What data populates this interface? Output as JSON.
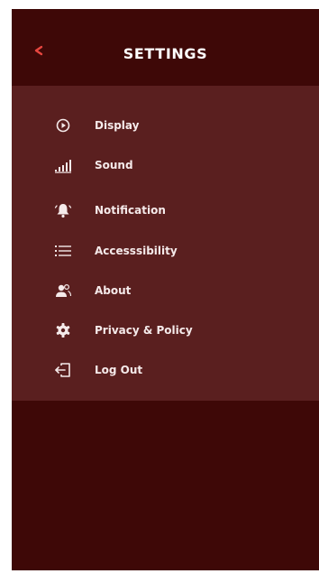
{
  "header": {
    "title": "SETTINGS",
    "back_icon": "chevron-left-icon",
    "accent": "#e8463f"
  },
  "menu": {
    "items": [
      {
        "label": "Display",
        "icon": "play-circle-icon"
      },
      {
        "label": "Sound",
        "icon": "equalizer-icon"
      },
      {
        "label": "Notification",
        "icon": "bell-ringing-icon"
      },
      {
        "label": "Accesssibility",
        "icon": "list-icon"
      },
      {
        "label": "About",
        "icon": "users-icon"
      },
      {
        "label": "Privacy & Policy",
        "icon": "gear-icon"
      },
      {
        "label": "Log Out",
        "icon": "logout-icon"
      }
    ]
  },
  "colors": {
    "background": "#3e0807",
    "panel": "#5a1f1f",
    "text": "#f5eaea"
  }
}
